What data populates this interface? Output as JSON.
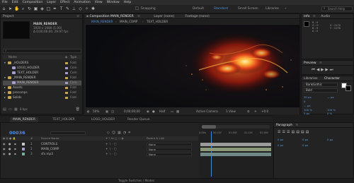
{
  "menu": [
    "File",
    "Edit",
    "Composition",
    "Layer",
    "Effect",
    "Animation",
    "View",
    "Window",
    "Help"
  ],
  "toolbar": {
    "snapping_label": "Snapping",
    "workspaces": [
      {
        "label": "Default",
        "active": false
      },
      {
        "label": "Standard",
        "active": true
      },
      {
        "label": "Small Screen",
        "active": false
      },
      {
        "label": "Libraries",
        "active": false
      }
    ],
    "search_placeholder": "Search Help"
  },
  "project": {
    "title": "Project",
    "comp_name": "MAIN_RENDER",
    "comp_info_1": "1920 x 1080 (1.00)",
    "comp_info_2": "Δ 0;00;06;00, 29.97 fps",
    "col_name": "Name",
    "col_type": "Type",
    "items": [
      {
        "label": "_HOLDERS",
        "type": "Fold",
        "indent": 0,
        "twirl": "▾",
        "icon": "folder",
        "swatch": "#c9a64a",
        "selected": false
      },
      {
        "label": "LOGO_HOLDER",
        "type": "Com",
        "indent": 1,
        "twirl": "",
        "icon": "comp",
        "swatch": "#a79bd0",
        "selected": false
      },
      {
        "label": "TEXT_HOLDER",
        "type": "Com",
        "indent": 1,
        "twirl": "",
        "icon": "comp",
        "swatch": "#a79bd0",
        "selected": false
      },
      {
        "label": "_MAIN_RENDER",
        "type": "Fold",
        "indent": 0,
        "twirl": "▾",
        "icon": "folder",
        "swatch": "#c9a64a",
        "selected": false
      },
      {
        "label": "MAIN_RENDER",
        "type": "Com",
        "indent": 1,
        "twirl": "",
        "icon": "comp",
        "swatch": "#a79bd0",
        "selected": true
      },
      {
        "label": "Assets",
        "type": "Fold",
        "indent": 0,
        "twirl": "▸",
        "icon": "folder",
        "swatch": "#c9a64a",
        "selected": false
      },
      {
        "label": "precomps",
        "type": "Fold",
        "indent": 0,
        "twirl": "▸",
        "icon": "folder",
        "swatch": "#c9a64a",
        "selected": false
      },
      {
        "label": "Solids",
        "type": "Fold",
        "indent": 0,
        "twirl": "▸",
        "icon": "folder",
        "swatch": "#c9a64a",
        "selected": false
      }
    ],
    "footer_bpc": "8 bpc"
  },
  "composition": {
    "panel_title": "Composition MAIN_RENDER",
    "other_tabs": [
      "Layer (none)",
      "Footage (none)"
    ],
    "view_tabs": [
      "MAIN_RENDER",
      "MAIN_COMP",
      "TEXT_HOLDER"
    ],
    "magnification": "50%",
    "timecode": "0;00;00;00",
    "resolution": "Half",
    "camera": "Active Camera",
    "views": "1 View",
    "offset": "+0.0"
  },
  "info": {
    "tabs": [
      "Info",
      "Audio"
    ],
    "r": "R : 0",
    "g": "G : 0",
    "b": "B : 0",
    "a": "A : 0",
    "x": "X : 2170",
    "y": "Y : 1278"
  },
  "preview": {
    "title": "Preview"
  },
  "character": {
    "tabs": [
      "Libraries",
      "Character"
    ],
    "font": "BankGothic",
    "style": "Bold",
    "size": "30 px",
    "leading": "— px",
    "px_label": "— px",
    "tracking": "0",
    "vscale": "100 %",
    "hscale": "100 %",
    "baseline": "0 px",
    "tsume": "0 %"
  },
  "paragraph": {
    "title": "Paragraph",
    "indent_left": "0 px",
    "indent_right": "0 px",
    "indent_first": "0 px",
    "space_before": "0 px",
    "space_after": "0 px"
  },
  "timeline": {
    "tabs": [
      {
        "label": "MAIN_RENDER",
        "active": true
      },
      {
        "label": "TEXT_HOLDER",
        "active": false
      },
      {
        "label": "LOGO_HOLDER",
        "active": false
      },
      {
        "label": "Render Queue",
        "active": false
      }
    ],
    "timecode": "00036",
    "col_source": "Source Name",
    "col_parent": "Parent & Link",
    "layers": [
      {
        "num": "1",
        "name": "CONTROLS",
        "parent": "None",
        "label_color": "#c8c8c8",
        "bar_color": "#9b9b9b"
      },
      {
        "num": "2",
        "name": "MAIN_COMP",
        "parent": "None",
        "label_color": "#a79bd0",
        "bar_color": "#8a9878"
      },
      {
        "num": "3",
        "name": "sfx.mp3",
        "parent": "None",
        "label_color": "#6fb0a0",
        "bar_color": "#6f8a86"
      }
    ],
    "ruler_marks": [
      "0:00s",
      "00:15f",
      "01:00f",
      "01:15f",
      "02:00f"
    ],
    "footer": "Toggle Switches / Modes"
  },
  "colors": {
    "accent": "#4f8fe0",
    "panel": "#232323",
    "background": "#1d1d1d"
  }
}
